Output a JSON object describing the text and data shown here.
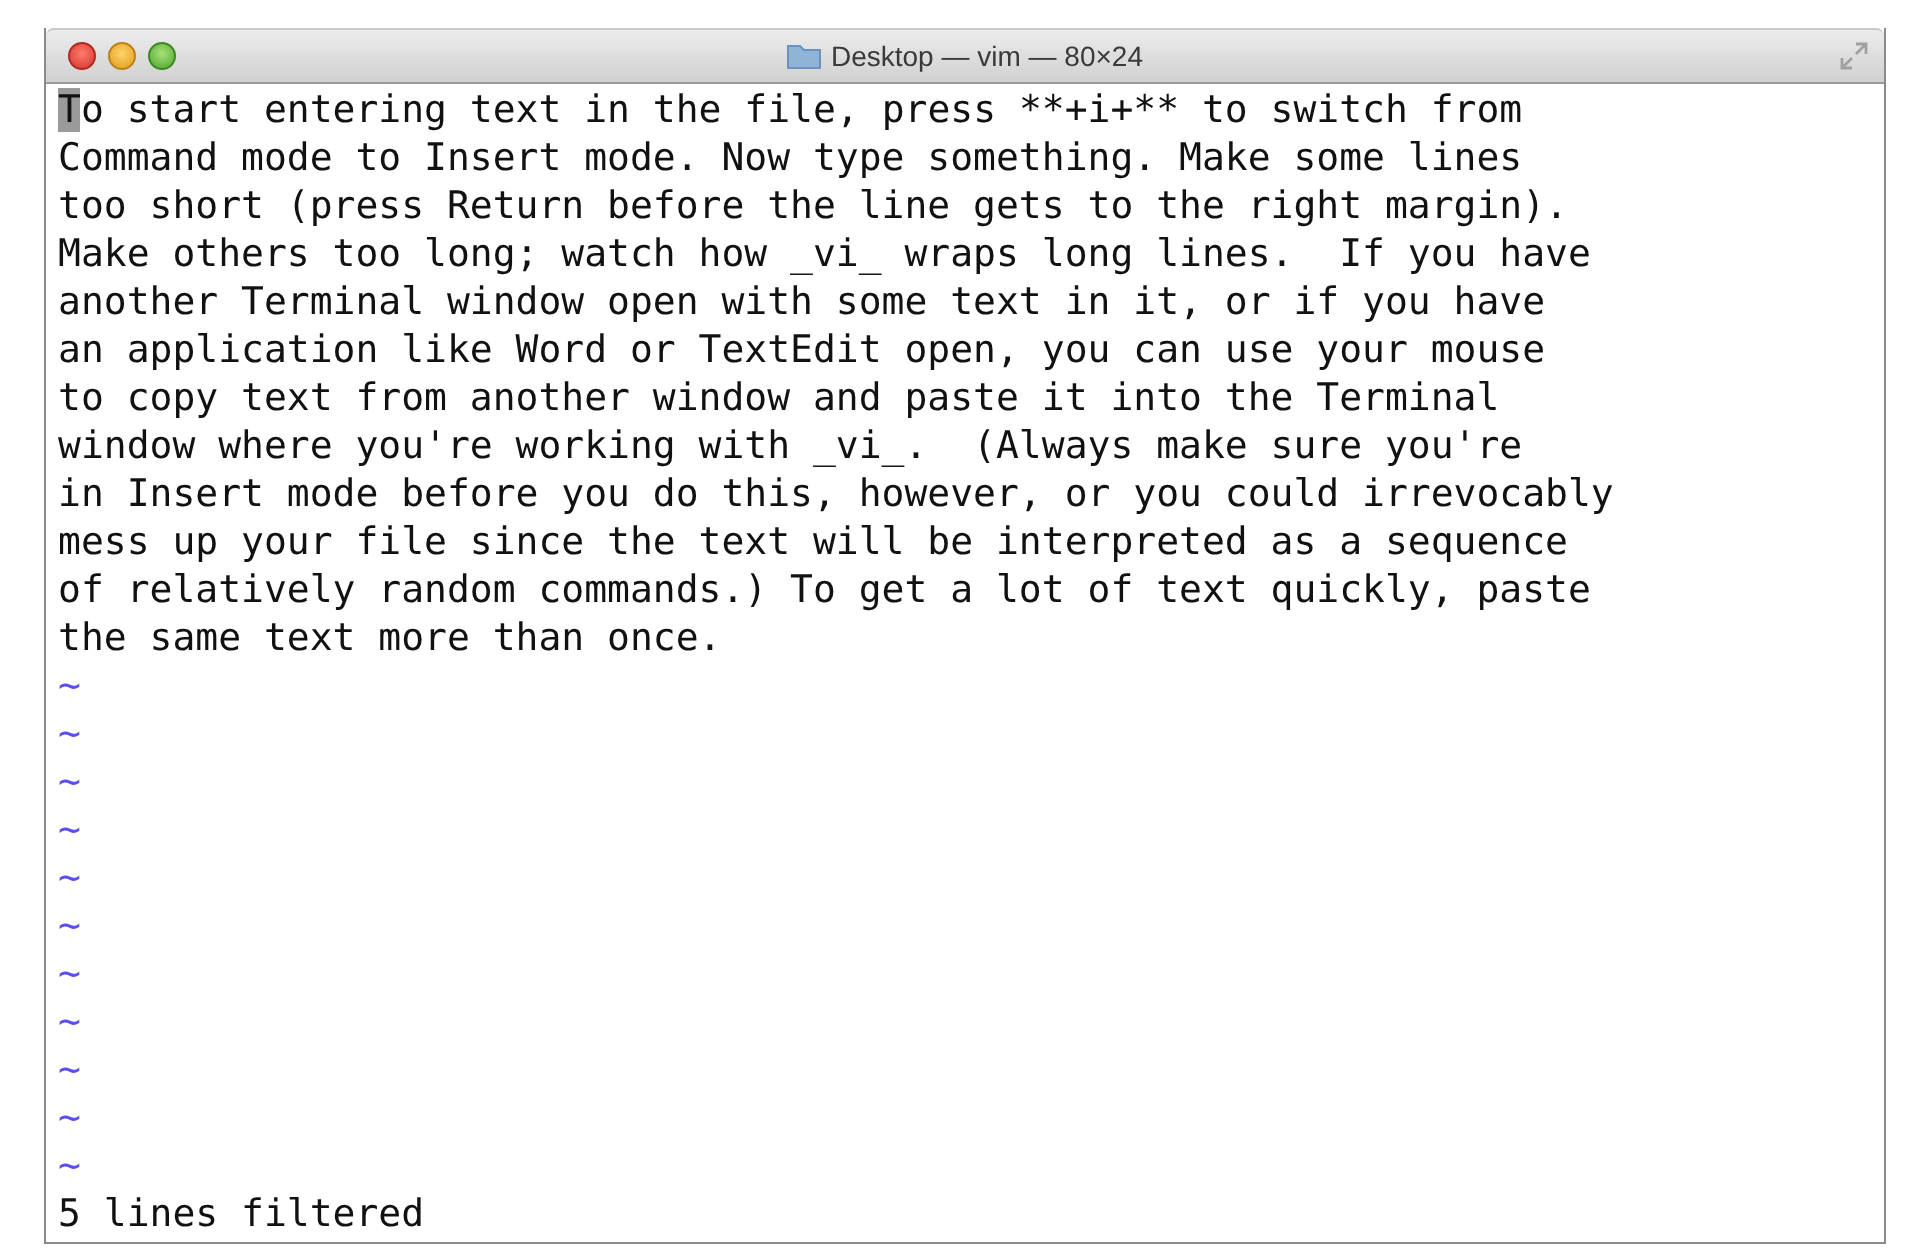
{
  "window": {
    "title": "Desktop — vim — 80×24"
  },
  "editor": {
    "lines": [
      {
        "text": "To start entering text in the file, press **+i+** to switch from",
        "cursor_at_start": true
      },
      {
        "text": "Command mode to Insert mode. Now type something. Make some lines",
        "cursor_at_start": false
      },
      {
        "text": "too short (press Return before the line gets to the right margin).",
        "cursor_at_start": false
      },
      {
        "text": "Make others too long; watch how _vi_ wraps long lines.  If you have",
        "cursor_at_start": false
      },
      {
        "text": "another Terminal window open with some text in it, or if you have",
        "cursor_at_start": false
      },
      {
        "text": "an application like Word or TextEdit open, you can use your mouse",
        "cursor_at_start": false
      },
      {
        "text": "to copy text from another window and paste it into the Terminal",
        "cursor_at_start": false
      },
      {
        "text": "window where you're working with _vi_.  (Always make sure you're",
        "cursor_at_start": false
      },
      {
        "text": "in Insert mode before you do this, however, or you could irrevocably",
        "cursor_at_start": false
      },
      {
        "text": "mess up your file since the text will be interpreted as a sequence",
        "cursor_at_start": false
      },
      {
        "text": "of relatively random commands.) To get a lot of text quickly, paste",
        "cursor_at_start": false
      },
      {
        "text": "the same text more than once.",
        "cursor_at_start": false
      }
    ],
    "empty_line_markers": [
      "~",
      "~",
      "~",
      "~",
      "~",
      "~",
      "~",
      "~",
      "~",
      "~",
      "~"
    ],
    "status_line": "5 lines filtered"
  }
}
